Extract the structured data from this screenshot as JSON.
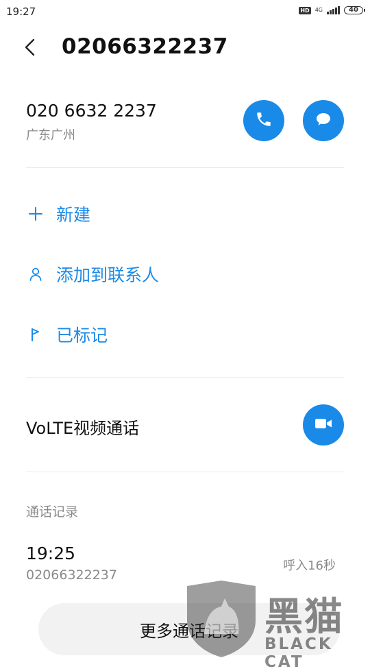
{
  "status_bar": {
    "time": "19:27",
    "hd_badge": "HD",
    "network_type": "4G",
    "battery_level": "40"
  },
  "header": {
    "back_icon": "chevron-left-icon",
    "title": "02066322237"
  },
  "contact": {
    "formatted_number": "020 6632 2237",
    "location": "广东广州",
    "call_icon": "phone-icon",
    "message_icon": "message-icon"
  },
  "actions": [
    {
      "label": "新建",
      "icon": "plus-icon"
    },
    {
      "label": "添加到联系人",
      "icon": "person-icon"
    },
    {
      "label": "已标记",
      "icon": "flag-icon"
    }
  ],
  "volte": {
    "label": "VoLTE视频通话",
    "icon": "video-camera-icon"
  },
  "call_log": {
    "section_title": "通话记录",
    "entries": [
      {
        "time": "19:25",
        "number": "02066322237",
        "detail": "呼入16秒"
      }
    ],
    "more_label": "更多通话记录"
  },
  "watermark": {
    "text_cn": "黑猫",
    "text_en": "BLACK CAT"
  },
  "colors": {
    "accent": "#1a8ae8",
    "secondary_text": "#8a8a8a",
    "divider": "#ececec"
  }
}
